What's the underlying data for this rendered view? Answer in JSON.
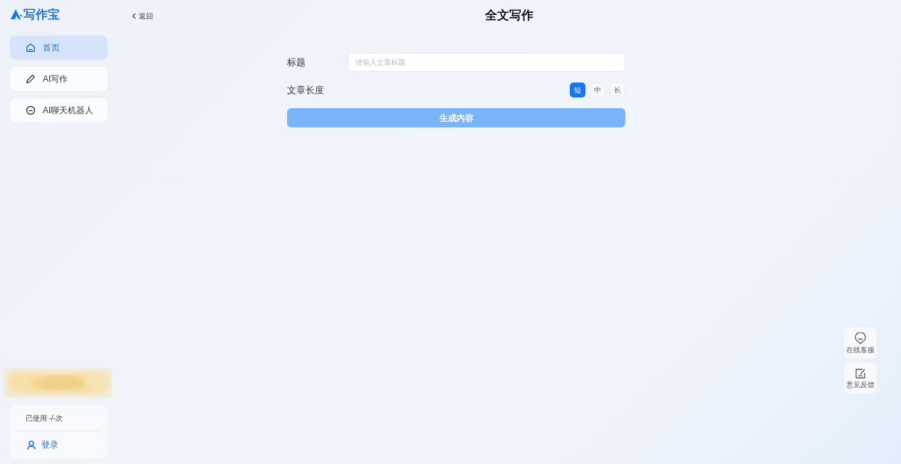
{
  "logo": {
    "text": "写作宝"
  },
  "sidebar": {
    "items": [
      {
        "label": "首页",
        "selected": true,
        "kind": "home"
      },
      {
        "label": "AI写作",
        "selected": false,
        "kind": "write"
      },
      {
        "label": "AI聊天机器人",
        "selected": false,
        "kind": "chat"
      }
    ]
  },
  "usage": {
    "text": "已使用 -/-次",
    "login": "登录"
  },
  "header": {
    "back": "返回",
    "title": "全文写作"
  },
  "form": {
    "title_label": "标题",
    "title_placeholder": "请输入文章标题",
    "length_label": "文章长度",
    "lengths": [
      {
        "label": "短",
        "selected": true
      },
      {
        "label": "中",
        "selected": false
      },
      {
        "label": "长",
        "selected": false
      }
    ],
    "submit": "生成内容"
  },
  "float_buttons": [
    {
      "label": "在线客服",
      "kind": "service"
    },
    {
      "label": "意见反馈",
      "kind": "feedback"
    }
  ]
}
